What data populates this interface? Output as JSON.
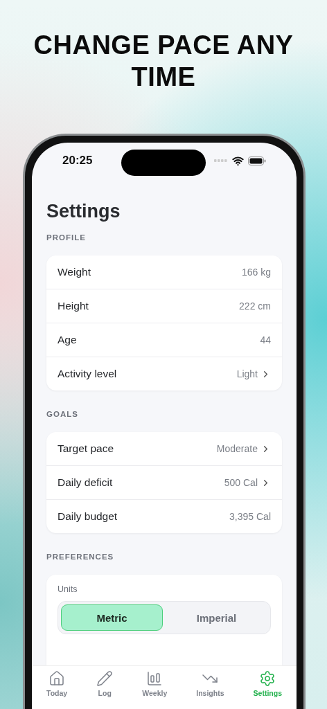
{
  "headline": "CHANGE PACE ANY TIME",
  "status_bar": {
    "time": "20:25"
  },
  "title": "Settings",
  "sections": [
    {
      "label": "PROFILE",
      "rows": [
        {
          "label": "Weight",
          "value": "166 kg",
          "chevron": false
        },
        {
          "label": "Height",
          "value": "222 cm",
          "chevron": false
        },
        {
          "label": "Age",
          "value": "44",
          "chevron": false
        },
        {
          "label": "Activity level",
          "value": "Light",
          "chevron": true
        }
      ]
    },
    {
      "label": "GOALS",
      "rows": [
        {
          "label": "Target pace",
          "value": "Moderate",
          "chevron": true
        },
        {
          "label": "Daily deficit",
          "value": "500 Cal",
          "chevron": true
        },
        {
          "label": "Daily budget",
          "value": "3,395 Cal",
          "chevron": false
        }
      ]
    }
  ],
  "preferences": {
    "label": "PREFERENCES",
    "units_label": "Units",
    "units": [
      {
        "label": "Metric",
        "selected": true
      },
      {
        "label": "Imperial",
        "selected": false
      }
    ]
  },
  "tab_bar": [
    {
      "label": "Today",
      "selected": false
    },
    {
      "label": "Log",
      "selected": false
    },
    {
      "label": "Weekly",
      "selected": false
    },
    {
      "label": "Insights",
      "selected": false
    },
    {
      "label": "Settings",
      "selected": true
    }
  ]
}
